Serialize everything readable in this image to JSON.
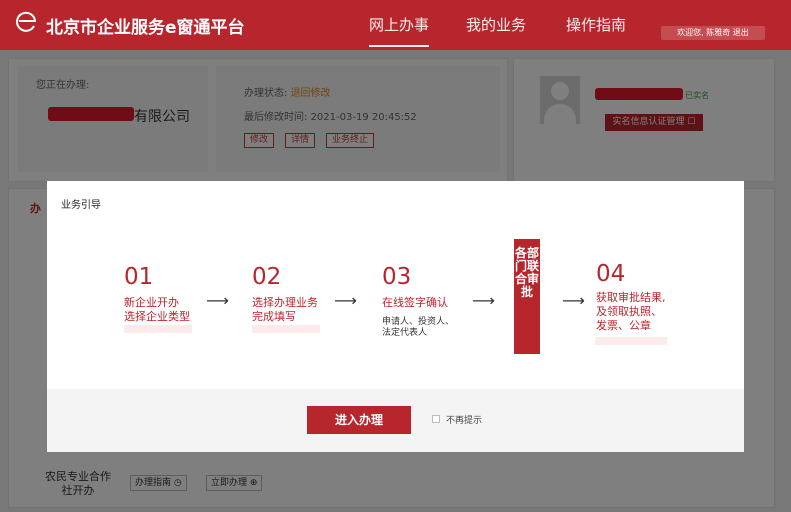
{
  "header": {
    "brand": "北京市企业服务e窗通平台",
    "nav": [
      "网上办事",
      "我的业务",
      "操作指南"
    ],
    "user_text": "欢迎您, 陈雅奇  退出"
  },
  "business": {
    "handling_label": "您正在办理:",
    "company_suffix": "有限公司",
    "status_label": "办理状态:",
    "status_value": "退回修改",
    "modified_label": "最后修改时间:",
    "modified_value": "2021-03-19 20:45:52",
    "buttons": [
      "修改",
      "详情",
      "业务终止"
    ]
  },
  "profile": {
    "verified": "已实名",
    "real_name_button": "实名信息认证管理"
  },
  "tab_mark": "办",
  "bottom": {
    "name": "农民专业合作社开办",
    "guide": "办理指南",
    "apply": "立即办理"
  },
  "modal": {
    "title": "业务引导",
    "steps": [
      {
        "num": "01",
        "line1": "新企业开办",
        "line2": "选择企业类型"
      },
      {
        "num": "02",
        "line1": "选择办理业务",
        "line2": "完成填写"
      },
      {
        "num": "03",
        "line1": "在线签字确认",
        "sub1": "申请人、投资人、",
        "sub2": "法定代表人"
      },
      {
        "num": "04",
        "line1": "获取审批结果,",
        "line2": "及领取执照、",
        "line3": "发票、公章"
      }
    ],
    "dept_label": "各部门联合审批",
    "arrow": "⟶",
    "enter_button": "进入办理",
    "dont_show": "不再提示"
  }
}
